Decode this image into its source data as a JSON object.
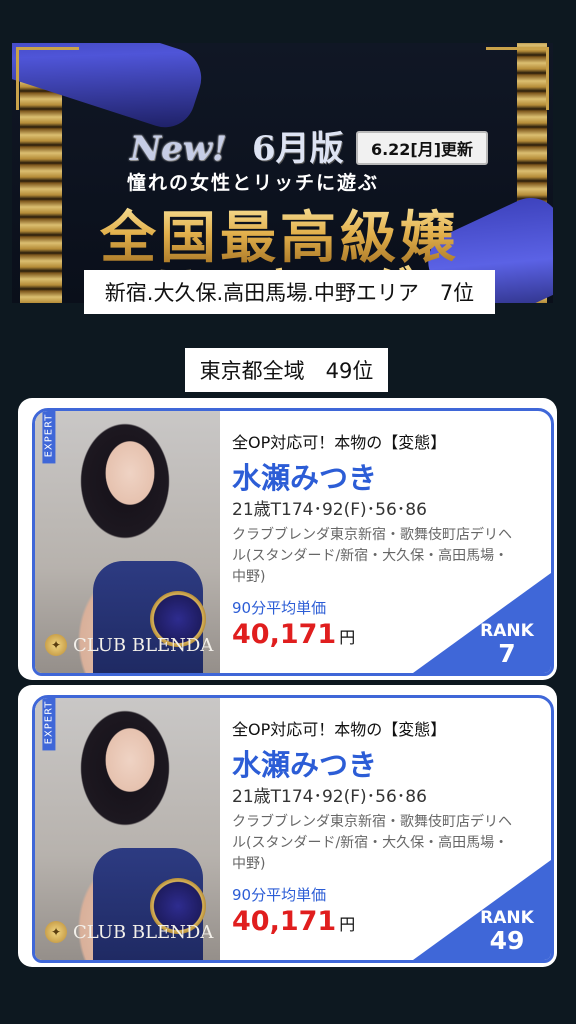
{
  "banner": {
    "new": "New!",
    "month": "6月版",
    "update_date": "6.22[月]更新",
    "subtitle": "憧れの女性とリッチに遊ぶ",
    "title_line1": "全国最高級嬢",
    "title_line2": "ランキング"
  },
  "area_rank_label": "新宿.大久保.高田馬場.中野エリア　7位",
  "tokyo_rank_label": "東京都全域　49位",
  "cards": [
    {
      "catch": "全OP対応可！本物の【変態】",
      "name": "水瀬みつき",
      "stats": "21歳T174･92(F)･56･86",
      "shop": "クラブブレンダ東京新宿・歌舞伎町店デリヘル(スタンダード/新宿・大久保・高田馬場・中野)",
      "price_label": "90分平均単価",
      "price": "40,171",
      "yen": "円",
      "rank_label": "RANK",
      "rank": "7",
      "brand": "CLUB BLENDA",
      "expert": "EXPERT"
    },
    {
      "catch": "全OP対応可！本物の【変態】",
      "name": "水瀬みつき",
      "stats": "21歳T174･92(F)･56･86",
      "shop": "クラブブレンダ東京新宿・歌舞伎町店デリヘル(スタンダード/新宿・大久保・高田馬場・中野)",
      "price_label": "90分平均単価",
      "price": "40,171",
      "yen": "円",
      "rank_label": "RANK",
      "rank": "49",
      "brand": "CLUB BLENDA",
      "expert": "EXPERT"
    }
  ],
  "colors": {
    "background": "#0d1820",
    "accent_blue": "#3f67d8",
    "price_red": "#e01e1e",
    "gold": "#e2b04c"
  }
}
